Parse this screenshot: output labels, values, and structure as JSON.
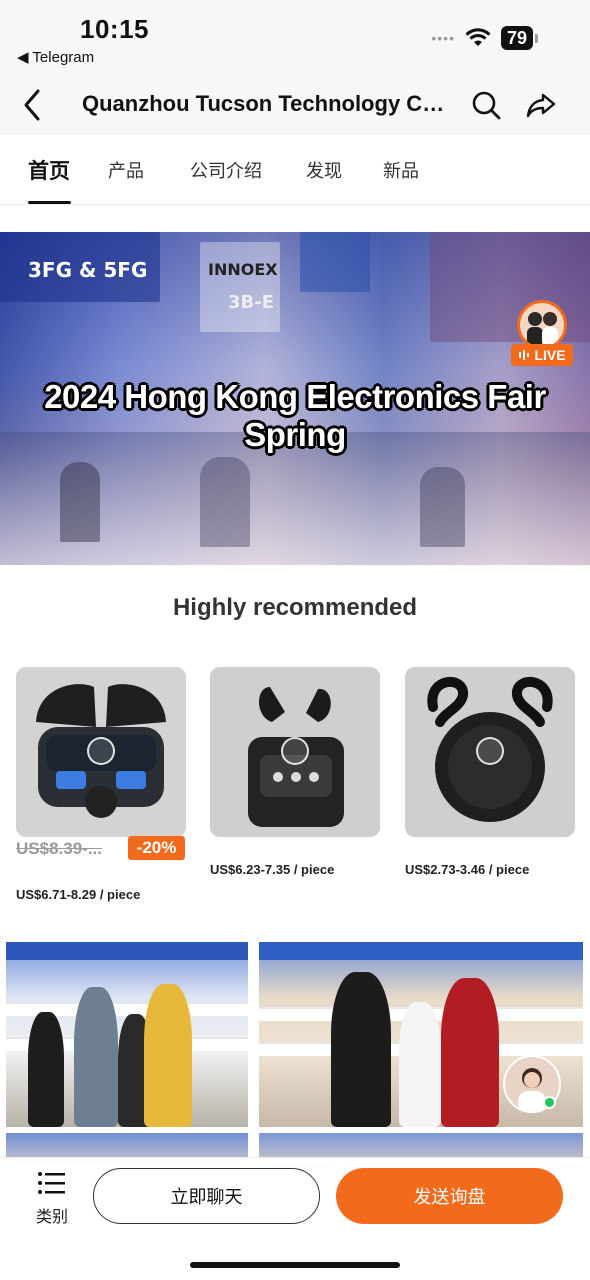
{
  "status_bar": {
    "time": "10:15",
    "back_app": "◀ Telegram",
    "battery": "79",
    "signal_dots": "••••"
  },
  "header": {
    "title": "Quanzhou Tucson Technology Co..."
  },
  "tabs": [
    {
      "label": "首页",
      "active": true
    },
    {
      "label": "产品"
    },
    {
      "label": "公司介绍"
    },
    {
      "label": "发现"
    },
    {
      "label": "新品"
    }
  ],
  "banner": {
    "title": "2024 Hong Kong Electronics Fair Spring",
    "live_label": "LIVE",
    "sign_left": "3FG & 5FG",
    "sign_hall": "3B-E",
    "sign_brand": "INNOEX"
  },
  "recommended": {
    "title": "Highly recommended",
    "products": [
      {
        "old_price": "US$8.39-...",
        "discount": "-20%",
        "price": "US$6.71-8.29 / piece"
      },
      {
        "price": "US$6.23-7.35 / piece"
      },
      {
        "price": "US$2.73-3.46 / piece"
      }
    ]
  },
  "bottom_bar": {
    "categories_label": "类别",
    "chat_label": "立即聊天",
    "inquiry_label": "发送询盘"
  },
  "colors": {
    "accent": "#f26a1b",
    "online": "#22c55e"
  }
}
